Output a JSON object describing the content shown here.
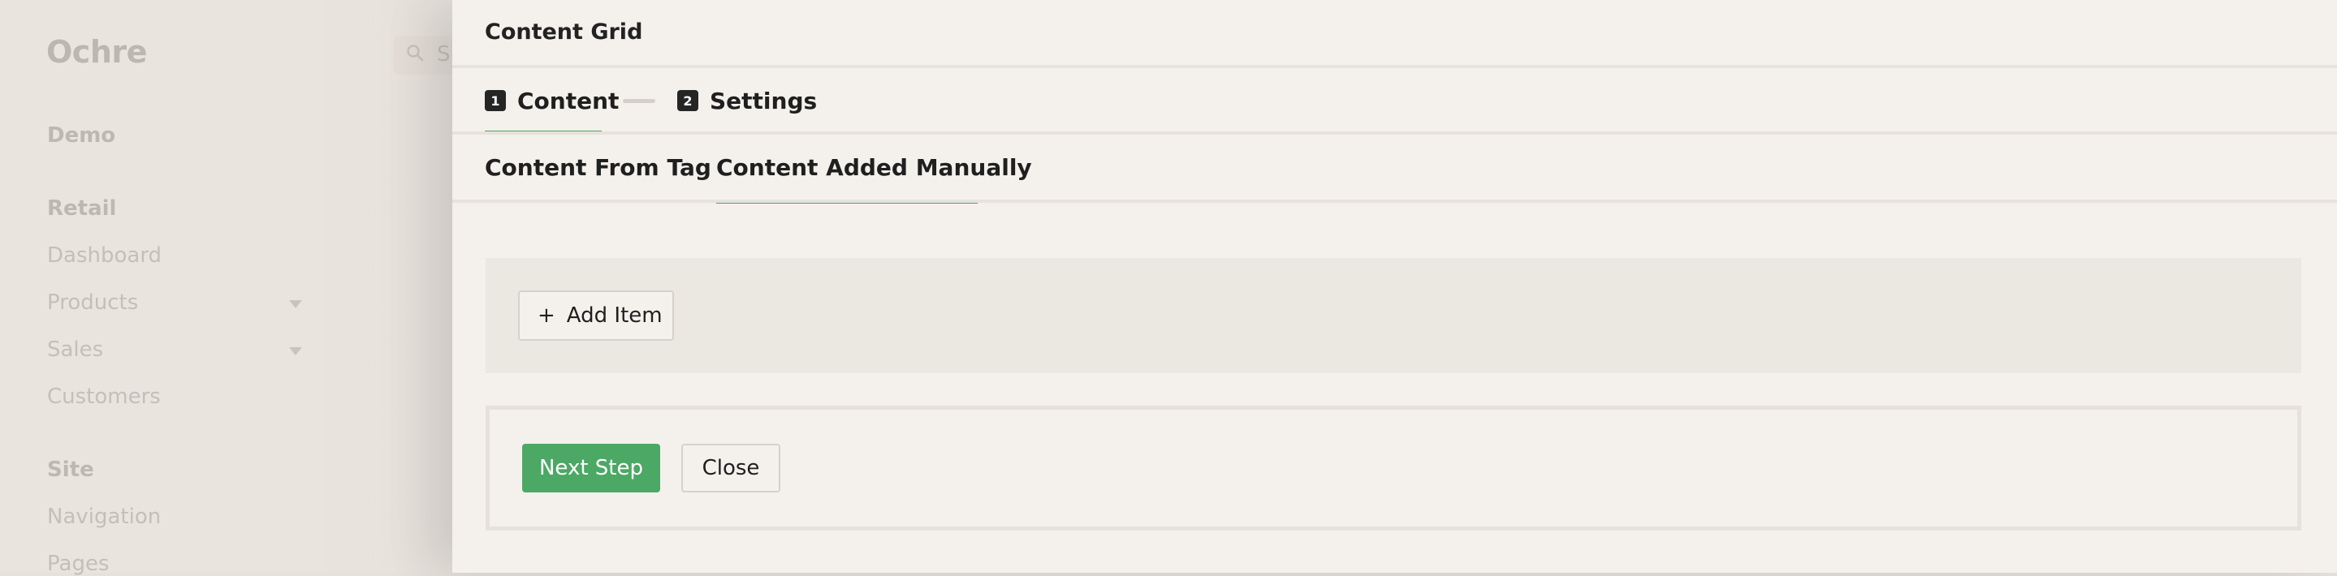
{
  "app": {
    "logo": "Ochre",
    "sidebar": {
      "org": "Demo",
      "sections": [
        {
          "heading": "Retail",
          "items": [
            "Dashboard",
            "Products",
            "Sales",
            "Customers"
          ]
        },
        {
          "heading": "Site",
          "items": [
            "Navigation",
            "Pages"
          ]
        }
      ]
    },
    "search": {
      "visible_text": "S"
    }
  },
  "panel": {
    "title": "Content Grid",
    "steps": [
      {
        "number": "1",
        "label": "Content",
        "active": true
      },
      {
        "number": "2",
        "label": "Settings",
        "active": false
      }
    ],
    "tabs": [
      {
        "label": "Content From Tag",
        "active": false
      },
      {
        "label": "Content Added Manually",
        "active": true
      }
    ],
    "add_item": {
      "icon": "plus-icon",
      "plus": "+",
      "label": "Add Item"
    },
    "actions": {
      "next_label": "Next Step",
      "close_label": "Close"
    }
  },
  "colors": {
    "accent": "#4ca865",
    "panel_bg": "#f4f1ec",
    "text": "#1f1f1f"
  }
}
